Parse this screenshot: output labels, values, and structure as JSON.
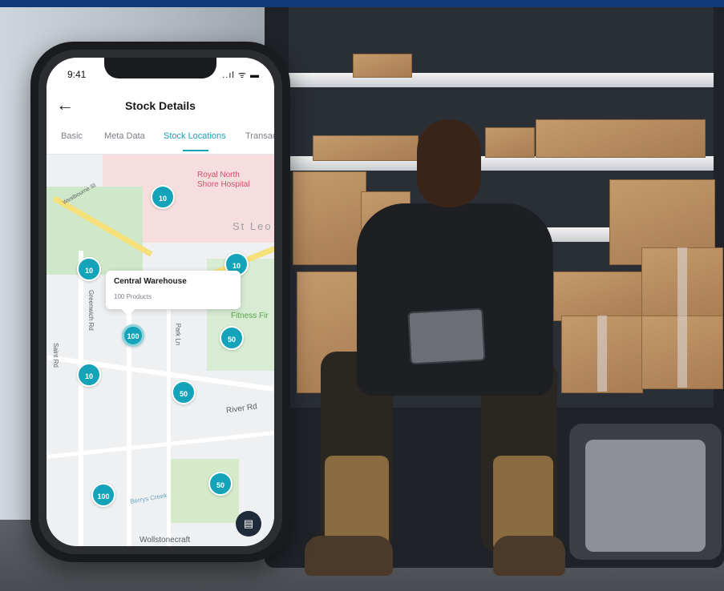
{
  "status": {
    "time": "9:41",
    "icons": "..ıl ᯤ ▬"
  },
  "nav": {
    "back": "←",
    "title": "Stock Details"
  },
  "tabs": [
    {
      "label": "Basic",
      "active": false
    },
    {
      "label": "Meta Data",
      "active": false
    },
    {
      "label": "Stock Locations",
      "active": true
    },
    {
      "label": "Transac",
      "active": false
    }
  ],
  "map": {
    "labels": {
      "hospital": "Royal North Shore Hospital",
      "hospital_line1": "Royal North",
      "hospital_line2": "Shore Hospital",
      "st_leo": "St Leo",
      "fitness": "Fitness Fir",
      "river_rd": "River Rd",
      "wollstonecraft": "Wollstonecraft",
      "berrys_creek": "Berrys Creek",
      "greenwich_rd": "Greenwich Rd",
      "saint_rd": "Saint Rd",
      "park_ln": "Park Ln",
      "westbourne_st": "Westbourne St"
    },
    "clusters": [
      {
        "id": "c1",
        "count": "10"
      },
      {
        "id": "c2",
        "count": "10"
      },
      {
        "id": "c3",
        "count": "10"
      },
      {
        "id": "c4",
        "count": "100"
      },
      {
        "id": "c5",
        "count": "50"
      },
      {
        "id": "c6",
        "count": "10"
      },
      {
        "id": "c7",
        "count": "50"
      },
      {
        "id": "c8",
        "count": "100"
      },
      {
        "id": "c9",
        "count": "50"
      }
    ],
    "tooltip": {
      "title": "Central Warehouse",
      "subtitle": "100 Products"
    },
    "fab_icon": "scan-icon"
  },
  "colors": {
    "accent": "#14a3b8",
    "topbar": "#0f3a7a",
    "fab": "#1f2a3a"
  }
}
